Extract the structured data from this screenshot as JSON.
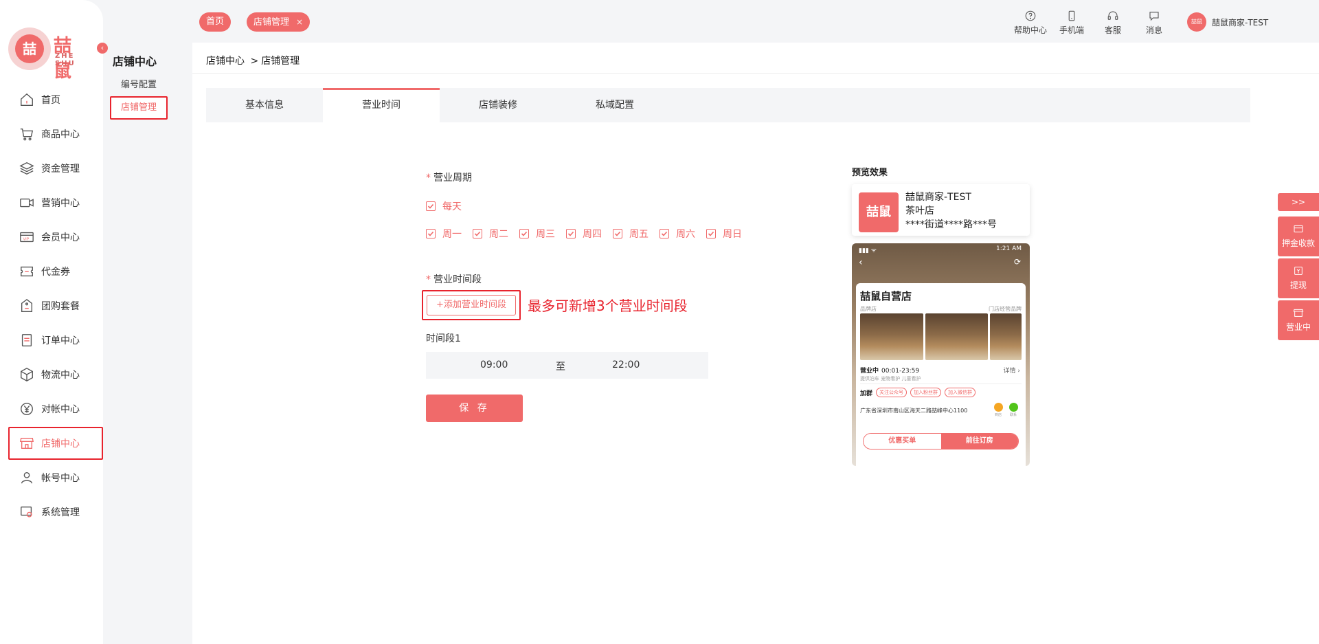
{
  "brand": {
    "name_cn": "喆鼠",
    "name_en": "ZHE SHU",
    "badge_text": "喆"
  },
  "colors": {
    "accent": "#f06a6a",
    "highlight_border": "#e8232d"
  },
  "sidebar": {
    "items": [
      {
        "label": "首页",
        "icon": "home-icon"
      },
      {
        "label": "商品中心",
        "icon": "cart-icon"
      },
      {
        "label": "资金管理",
        "icon": "layers-icon"
      },
      {
        "label": "营销中心",
        "icon": "video-icon"
      },
      {
        "label": "会员中心",
        "icon": "vip-card-icon"
      },
      {
        "label": "代金券",
        "icon": "coupon-icon"
      },
      {
        "label": "团购套餐",
        "icon": "tag-icon"
      },
      {
        "label": "订单中心",
        "icon": "document-icon"
      },
      {
        "label": "物流中心",
        "icon": "box-icon"
      },
      {
        "label": "对帐中心",
        "icon": "yen-icon"
      },
      {
        "label": "店铺中心",
        "icon": "store-icon",
        "active": true
      },
      {
        "label": "帐号中心",
        "icon": "user-icon"
      },
      {
        "label": "系统管理",
        "icon": "settings-icon"
      }
    ]
  },
  "subnav": {
    "title": "店铺中心",
    "items": [
      {
        "label": "编号配置"
      },
      {
        "label": "店铺管理",
        "active": true
      }
    ]
  },
  "topbar": {
    "tabs": [
      {
        "label": "首页"
      },
      {
        "label": "店铺管理",
        "close": "×"
      }
    ],
    "tools": [
      {
        "label": "帮助中心",
        "icon": "help-icon"
      },
      {
        "label": "手机端",
        "icon": "mobile-icon"
      },
      {
        "label": "客服",
        "icon": "headset-icon"
      },
      {
        "label": "消息",
        "icon": "message-icon"
      }
    ],
    "user": {
      "name": "喆鼠商家-TEST",
      "avatar_text": "喆鼠"
    }
  },
  "breadcrumb": {
    "parent": "店铺中心",
    "separator": ">",
    "current": "店铺管理"
  },
  "tabs": [
    {
      "label": "基本信息"
    },
    {
      "label": "营业时间",
      "active": true
    },
    {
      "label": "店铺装修"
    },
    {
      "label": "私域配置"
    }
  ],
  "form": {
    "required_mark": "*",
    "cycle_label": "营业周期",
    "everyday_label": "每天",
    "days": [
      "周一",
      "周二",
      "周三",
      "周四",
      "周五",
      "周六",
      "周日"
    ],
    "period_label": "营业时间段",
    "add_button": "+添加营业时间段",
    "hint": "最多可新增3个营业时间段",
    "slot_label": "时间段1",
    "slot_start": "09:00",
    "slot_to": "至",
    "slot_end": "22:00",
    "save_button": "保 存"
  },
  "preview": {
    "label": "预览效果",
    "card": {
      "thumb_text": "喆鼠",
      "name": "喆鼠商家-TEST",
      "type": "茶叶店",
      "address": "****街道****路***号"
    },
    "phone": {
      "signal": "▮▮▮ ᯤ",
      "time": "1:21 AM",
      "back": "‹",
      "share": "⟳",
      "title": "喆鼠自营店",
      "category": "品牌店",
      "category_right": "门店经营品牌",
      "open_status": "营业中",
      "open_hours": "00:01-23:59",
      "details": "详情 ›",
      "features": "提供泊车   宠物看护   儿童看护",
      "join_label": "加群",
      "join_tags": [
        "关注公众号",
        "加入粉丝群",
        "加入微信群"
      ],
      "address": "广东省深圳市南山区海天二路喆峰中心1100",
      "icon_labels": [
        "到店",
        "联系"
      ],
      "btn_left": "优惠买单",
      "btn_right": "前往订房"
    }
  },
  "floating": {
    "expand": ">>",
    "items": [
      {
        "label": "押金收款",
        "icon": "deposit-icon"
      },
      {
        "label": "提现",
        "icon": "withdraw-icon"
      },
      {
        "label": "营业中",
        "icon": "open-store-icon"
      }
    ]
  }
}
